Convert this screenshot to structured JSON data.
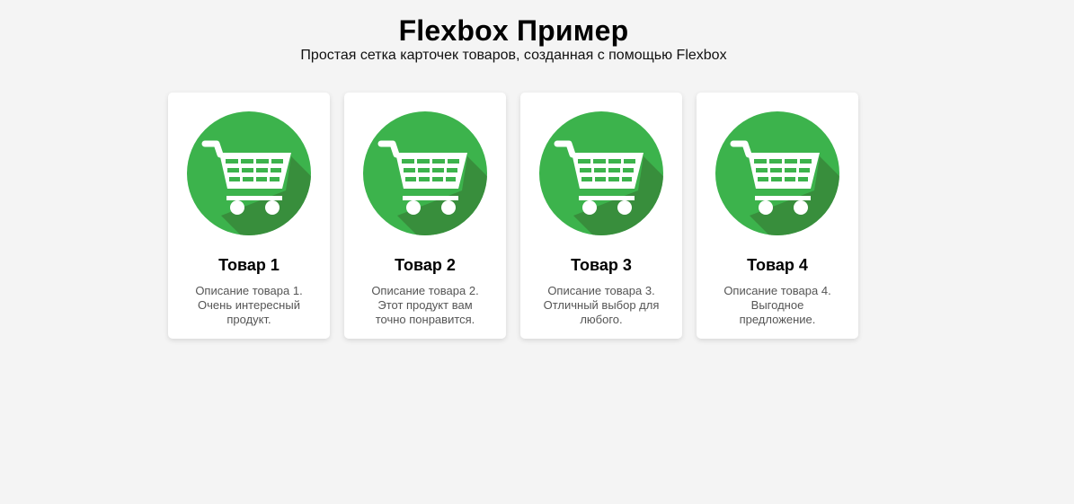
{
  "header": {
    "title": "Flexbox Пример",
    "subtitle": "Простая сетка карточек товаров, созданная с помощью Flexbox"
  },
  "colors": {
    "background": "#f4f4f4",
    "card": "#ffffff",
    "circle_green": "#3cb34c",
    "shadow_green": "#388e3c"
  },
  "products": [
    {
      "title": "Товар 1",
      "description": "Описание товара 1. Очень интересный продукт.",
      "icon": "shopping-cart-icon"
    },
    {
      "title": "Товар 2",
      "description": "Описание товара 2. Этот продукт вам точно понравится.",
      "icon": "shopping-cart-icon"
    },
    {
      "title": "Товар 3",
      "description": "Описание товара 3. Отличный выбор для любого.",
      "icon": "shopping-cart-icon"
    },
    {
      "title": "Товар 4",
      "description": "Описание товара 4. Выгодное предложение.",
      "icon": "shopping-cart-icon"
    }
  ]
}
